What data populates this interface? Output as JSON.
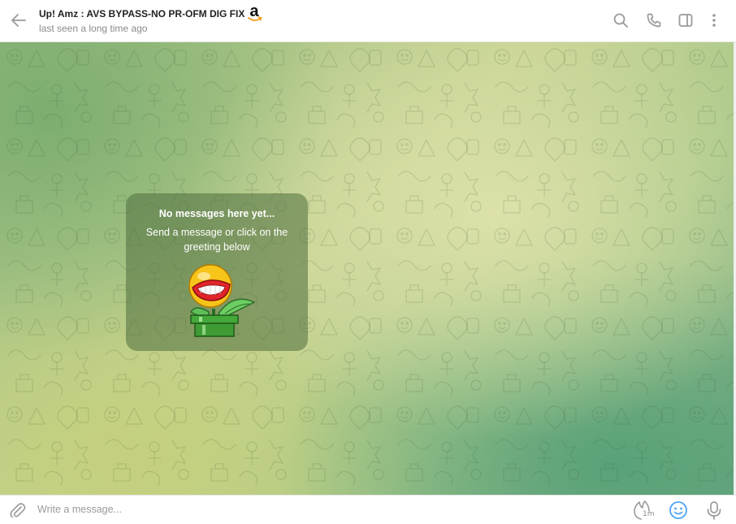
{
  "header": {
    "title": "Up! Amz : AVS BYPASS-NO PR-OFM DIG FIX",
    "title_logo": "amazon-logo",
    "status": "last seen a long time ago",
    "icons": [
      "arrow-left-icon",
      "search-icon",
      "phone-icon",
      "sidebar-toggle-icon",
      "more-vertical-icon"
    ]
  },
  "empty_state": {
    "title": "No messages here yet...",
    "subtitle": "Send a message or click on the greeting below",
    "sticker": "piranha-plant-sticker"
  },
  "composer": {
    "placeholder": "Write a message...",
    "icons": [
      "paperclip-icon",
      "timer-icon",
      "emoji-icon",
      "microphone-icon"
    ],
    "timer_label": "1m"
  },
  "colors": {
    "accent": "#3390ec",
    "icon_gray": "#9a9a9a",
    "card_bg": "#4e6e3e",
    "emoji_blue": "#4ea4f6"
  }
}
